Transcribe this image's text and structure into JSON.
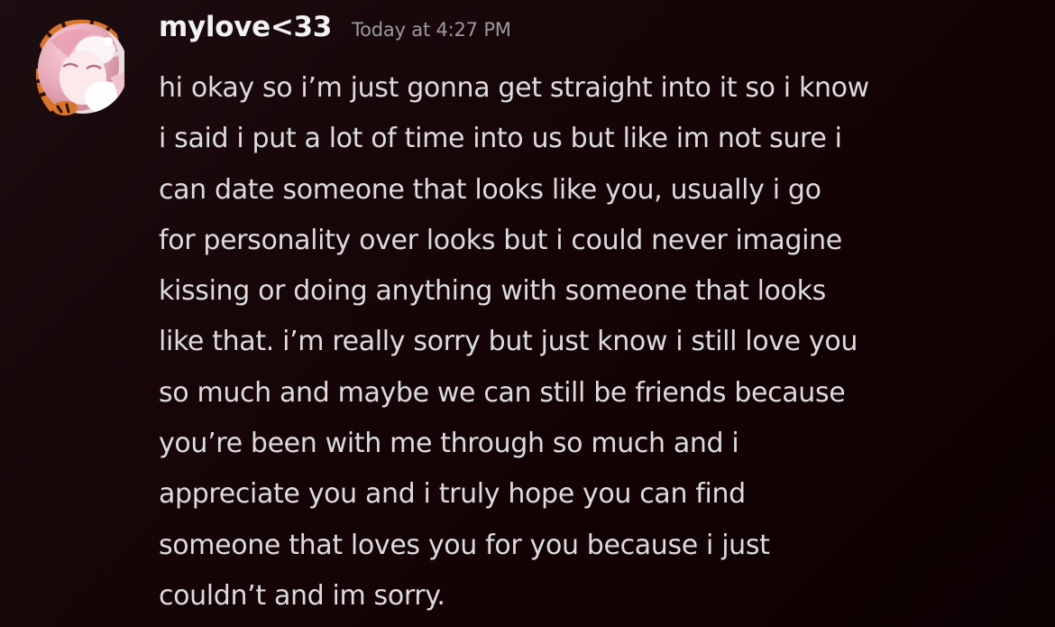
{
  "message": {
    "author": "mylove<33",
    "timestamp": "Today at 4:27 PM",
    "avatar_icon": "anime-girl-avatar-icon",
    "lines": [
      "hi okay so i’m just gonna get straight into it so i know",
      "i said i put a lot of time into us but like im not sure i",
      "can date someone that looks like you, usually i go",
      "for personality over looks but i could never imagine",
      "kissing or doing anything with someone that looks",
      "like that. i’m really sorry but just know i still love you",
      "so much and maybe we can still be friends because",
      "you’re been with me through so much and i",
      "appreciate you and i truly hope you can find",
      "someone that loves you for you because i just",
      "couldn’t and im sorry."
    ]
  },
  "colors": {
    "username": "#f2f2f4",
    "timestamp": "#9a9aa2",
    "message_text": "#dcdce0",
    "background": "#170608"
  }
}
